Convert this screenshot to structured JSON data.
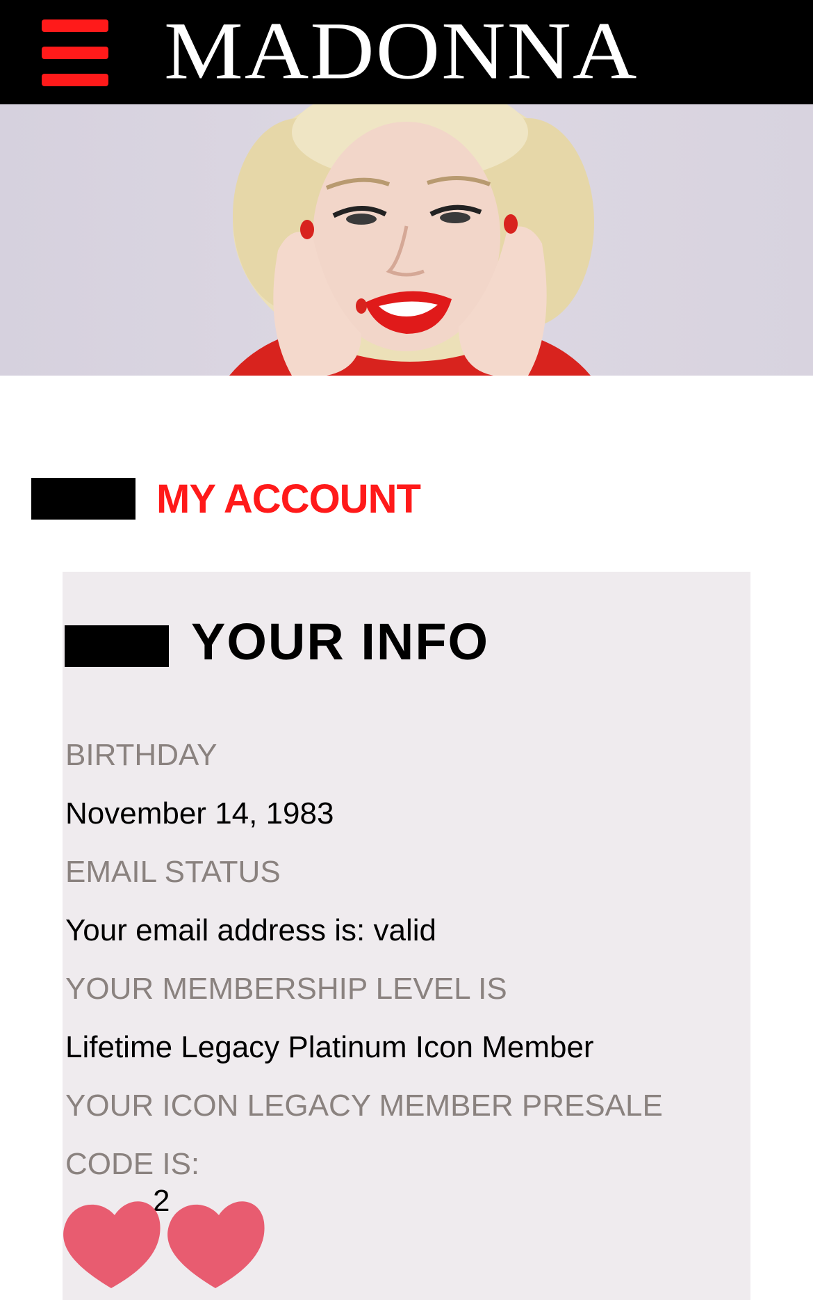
{
  "header": {
    "logo": "MADONNA",
    "menu_icon": "hamburger-menu-icon"
  },
  "hero": {
    "alt": "Madonna portrait with red lips and red nails"
  },
  "section": {
    "title": "MY ACCOUNT"
  },
  "info": {
    "title": "YOUR INFO",
    "fields": [
      {
        "label": "BIRTHDAY",
        "value": "November 14, 1983"
      },
      {
        "label": "EMAIL STATUS",
        "value": "Your email address is: valid"
      },
      {
        "label": "YOUR MEMBERSHIP LEVEL IS",
        "value": "Lifetime Legacy Platinum Icon Member"
      }
    ],
    "presale_label_line1": "YOUR ICON LEGACY MEMBER PRESALE",
    "presale_label_line2": "CODE IS:",
    "presale_code_visible": "2"
  },
  "colors": {
    "brand_red": "#ff1a1a",
    "header_bg": "#000000",
    "card_bg": "#efebee",
    "label_gray": "#8a827f",
    "heart_pink": "#e85c70"
  }
}
